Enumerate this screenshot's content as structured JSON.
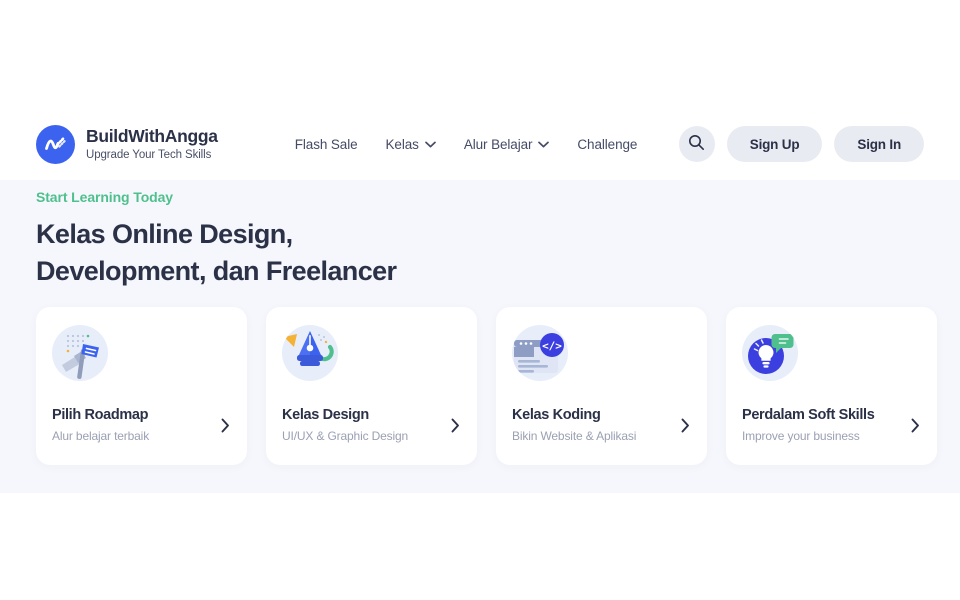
{
  "theme": {
    "brand_blue": "#3b63f0",
    "accent_green": "#4fc08d",
    "accent_yellow": "#f5b335",
    "text_dark": "#2b3147",
    "text_muted": "#9ba0b3",
    "hero_bg": "#f6f7fc",
    "pill_bg": "#e9ebf3",
    "icon_disc_bg": "#e8edfa"
  },
  "header": {
    "brand": {
      "name": "BuildWithAngga",
      "tagline": "Upgrade Your Tech Skills",
      "logo_icon": "wave-logo-icon"
    },
    "nav_items": [
      {
        "label": "Flash Sale",
        "has_dropdown": false
      },
      {
        "label": "Kelas",
        "has_dropdown": true
      },
      {
        "label": "Alur Belajar",
        "has_dropdown": true
      },
      {
        "label": "Challenge",
        "has_dropdown": false
      }
    ],
    "search_icon": "search-icon",
    "sign_up_label": "Sign Up",
    "sign_in_label": "Sign In"
  },
  "hero": {
    "eyebrow": "Start Learning Today",
    "title": "Kelas Online Design,\nDevelopment, dan Freelancer"
  },
  "cards": [
    {
      "title": "Pilih Roadmap",
      "subtitle": "Alur belajar terbaik",
      "icon": "flag-roadmap-icon",
      "chevron_icon": "chevron-right-icon"
    },
    {
      "title": "Kelas Design",
      "subtitle": "UI/UX & Graphic Design",
      "icon": "pen-nib-icon",
      "chevron_icon": "chevron-right-icon"
    },
    {
      "title": "Kelas Koding",
      "subtitle": "Bikin Website & Aplikasi",
      "icon": "code-browser-icon",
      "chevron_icon": "chevron-right-icon"
    },
    {
      "title": "Perdalam Soft Skills",
      "subtitle": "Improve your business",
      "icon": "lightbulb-chat-icon",
      "chevron_icon": "chevron-right-icon"
    }
  ]
}
